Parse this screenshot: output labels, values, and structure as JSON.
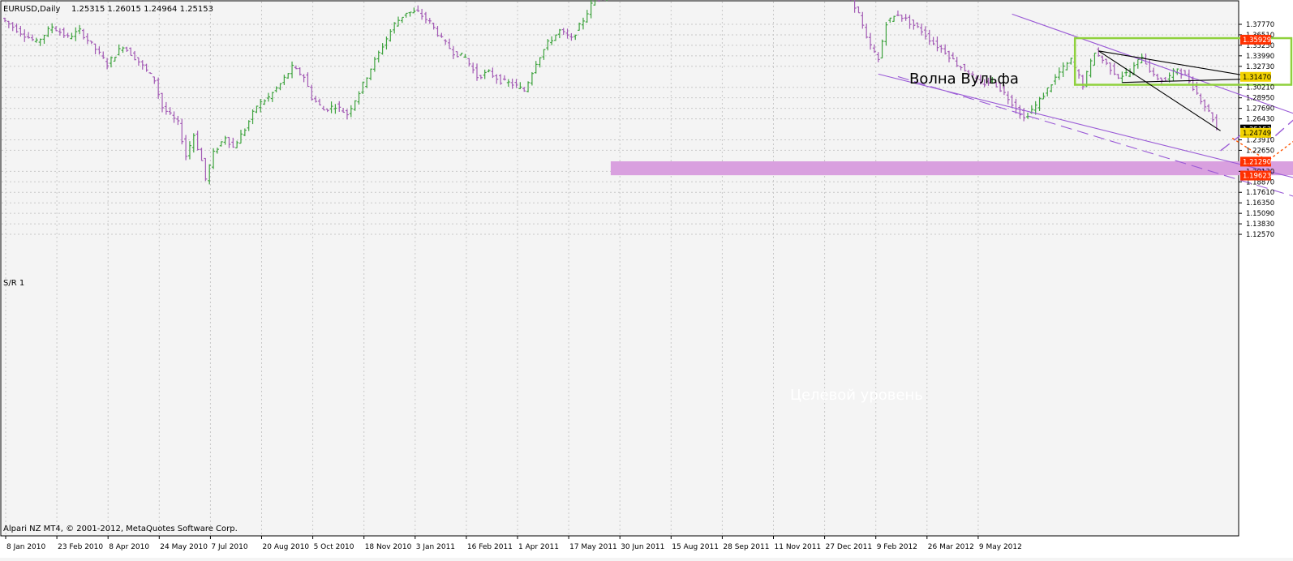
{
  "header": {
    "symbol": "EURUSD,Daily",
    "ohlc": "1.25315 1.26015 1.24964 1.25153"
  },
  "footer": {
    "copyright": "Alpari NZ MT4, © 2001-2012, MetaQuotes Software Corp."
  },
  "colors": {
    "background": "#f4f4f4",
    "grid": "#c8c8c8",
    "bull": "#3fa33f",
    "bear": "#a35bb5",
    "resistance_line": "#ff3000",
    "support_line": "#f2d200",
    "pattern_box": "#8fd13d",
    "channel": "#9a5ad6",
    "target_zone": "#d9a0df",
    "projection": "#ff5500"
  },
  "chart_data": {
    "type": "candlestick",
    "timeframe": "Daily",
    "ylim": [
      1.1257,
      1.389
    ],
    "x_tick_labels": [
      "8 Jan 2010",
      "23 Feb 2010",
      "8 Apr 2010",
      "24 May 2010",
      "7 Jul 2010",
      "20 Aug 2010",
      "5 Oct 2010",
      "18 Nov 2010",
      "3 Jan 2011",
      "16 Feb 2011",
      "1 Apr 2011",
      "17 May 2011",
      "30 Jun 2011",
      "15 Aug 2011",
      "28 Sep 2011",
      "11 Nov 2011",
      "27 Dec 2011",
      "9 Feb 2012",
      "26 Mar 2012",
      "9 May 2012"
    ],
    "y_ticks": [
      "1.37770",
      "1.36510",
      "1.35250",
      "1.33990",
      "1.32730",
      "1.30210",
      "1.28950",
      "1.27690",
      "1.26430",
      "1.23910",
      "1.22650",
      "1.20130",
      "1.18870",
      "1.17610",
      "1.16350",
      "1.15090",
      "1.13830",
      "1.12570"
    ],
    "price_markers": [
      {
        "label": "1.35929",
        "kind": "resistance"
      },
      {
        "label": "1.31470",
        "kind": "support"
      },
      {
        "label": "1.25153",
        "kind": "current"
      },
      {
        "label": "1.24749",
        "kind": "support"
      },
      {
        "label": "1.21290",
        "kind": "resistance"
      },
      {
        "label": "1.19623",
        "kind": "resistance"
      }
    ],
    "horizontal_levels": [
      {
        "value": 1.35929,
        "color": "resistance"
      },
      {
        "value": 1.3147,
        "color": "support"
      },
      {
        "value": 1.24749,
        "color": "support"
      },
      {
        "value": 1.2129,
        "color": "resistance"
      },
      {
        "value": 1.19623,
        "color": "resistance"
      }
    ],
    "sr_label": "S/R 1",
    "annotations": {
      "wolfe_wave": "Волна Вульфа",
      "target_level": "Целевой уровень"
    },
    "price_path": [
      [
        0,
        1.385
      ],
      [
        5,
        1.368
      ],
      [
        9,
        1.356
      ],
      [
        13,
        1.375
      ],
      [
        17,
        1.362
      ],
      [
        20,
        1.37
      ],
      [
        24,
        1.348
      ],
      [
        27,
        1.33
      ],
      [
        31,
        1.352
      ],
      [
        35,
        1.333
      ],
      [
        39,
        1.311
      ],
      [
        41,
        1.278
      ],
      [
        45,
        1.259
      ],
      [
        47,
        1.22
      ],
      [
        49,
        1.245
      ],
      [
        51,
        1.214
      ],
      [
        52,
        1.192
      ],
      [
        54,
        1.223
      ],
      [
        57,
        1.243
      ],
      [
        59,
        1.23
      ],
      [
        62,
        1.252
      ],
      [
        65,
        1.28
      ],
      [
        68,
        1.29
      ],
      [
        71,
        1.306
      ],
      [
        74,
        1.326
      ],
      [
        77,
        1.315
      ],
      [
        79,
        1.29
      ],
      [
        82,
        1.275
      ],
      [
        85,
        1.28
      ],
      [
        88,
        1.27
      ],
      [
        91,
        1.296
      ],
      [
        94,
        1.325
      ],
      [
        97,
        1.352
      ],
      [
        100,
        1.378
      ],
      [
        103,
        1.392
      ],
      [
        106,
        1.392
      ],
      [
        109,
        1.38
      ],
      [
        112,
        1.36
      ],
      [
        115,
        1.344
      ],
      [
        118,
        1.338
      ],
      [
        121,
        1.315
      ],
      [
        124,
        1.32
      ],
      [
        127,
        1.31
      ],
      [
        130,
        1.306
      ],
      [
        133,
        1.298
      ],
      [
        136,
        1.332
      ],
      [
        139,
        1.355
      ],
      [
        142,
        1.37
      ],
      [
        145,
        1.36
      ],
      [
        148,
        1.383
      ],
      [
        151,
        1.41
      ],
      [
        163,
        1.43
      ],
      [
        178,
        1.435
      ],
      [
        190,
        1.44
      ],
      [
        206,
        1.43
      ],
      [
        216,
        1.41
      ],
      [
        218,
        1.39
      ],
      [
        220,
        1.36
      ],
      [
        223,
        1.335
      ],
      [
        225,
        1.38
      ],
      [
        228,
        1.39
      ],
      [
        231,
        1.38
      ],
      [
        234,
        1.37
      ],
      [
        237,
        1.355
      ],
      [
        240,
        1.345
      ],
      [
        243,
        1.33
      ],
      [
        246,
        1.32
      ],
      [
        249,
        1.305
      ],
      [
        252,
        1.31
      ],
      [
        255,
        1.295
      ],
      [
        258,
        1.278
      ],
      [
        260,
        1.265
      ],
      [
        263,
        1.28
      ],
      [
        266,
        1.3
      ],
      [
        269,
        1.32
      ],
      [
        272,
        1.335
      ],
      [
        275,
        1.305
      ],
      [
        278,
        1.345
      ],
      [
        281,
        1.33
      ],
      [
        284,
        1.315
      ],
      [
        287,
        1.32
      ],
      [
        290,
        1.34
      ],
      [
        293,
        1.315
      ],
      [
        296,
        1.31
      ],
      [
        299,
        1.325
      ],
      [
        302,
        1.31
      ],
      [
        304,
        1.295
      ],
      [
        306,
        1.28
      ],
      [
        308,
        1.265
      ],
      [
        309,
        1.252
      ]
    ],
    "pattern": {
      "box": {
        "x": [
          272,
          327
        ],
        "y": [
          1.3052,
          1.3611
        ]
      },
      "wolfe_lines": [
        {
          "from": [
            278,
            1.3458
          ],
          "to": [
            320,
            1.3125
          ]
        },
        {
          "from": [
            278,
            1.3458
          ],
          "to": [
            309,
            1.25
          ]
        },
        {
          "from": [
            284,
            1.308
          ],
          "to": [
            320,
            1.3125
          ]
        }
      ]
    },
    "target_zone": {
      "x": [
        154,
        350
      ],
      "y": [
        1.1966,
        1.2133
      ]
    },
    "channel_lines": [
      {
        "from": [
          256,
          1.39
        ],
        "to": [
          391,
          1.165
        ],
        "style": "solid"
      },
      {
        "from": [
          222,
          1.318
        ],
        "to": [
          386,
          1.125
        ],
        "style": "solid"
      },
      {
        "from": [
          227,
          1.315
        ],
        "to": [
          360,
          1.125
        ],
        "style": "dashed"
      }
    ],
    "projections": [
      {
        "style": "dashed",
        "color": "channel",
        "points": [
          [
            309,
            1.226
          ],
          [
            317,
            1.255
          ],
          [
            322,
            1.24
          ],
          [
            328,
            1.265
          ],
          [
            332,
            1.246
          ],
          [
            344,
            1.151
          ],
          [
            361,
            1.246
          ],
          [
            372,
            1.2
          ],
          [
            390,
            1.317
          ]
        ]
      },
      {
        "style": "dotted",
        "color": "projection",
        "points": [
          [
            312,
            1.241
          ],
          [
            321,
            1.214
          ],
          [
            330,
            1.246
          ],
          [
            340,
            1.214
          ],
          [
            352,
            1.259
          ],
          [
            357,
            1.244
          ],
          [
            371,
            1.317
          ]
        ]
      }
    ]
  }
}
